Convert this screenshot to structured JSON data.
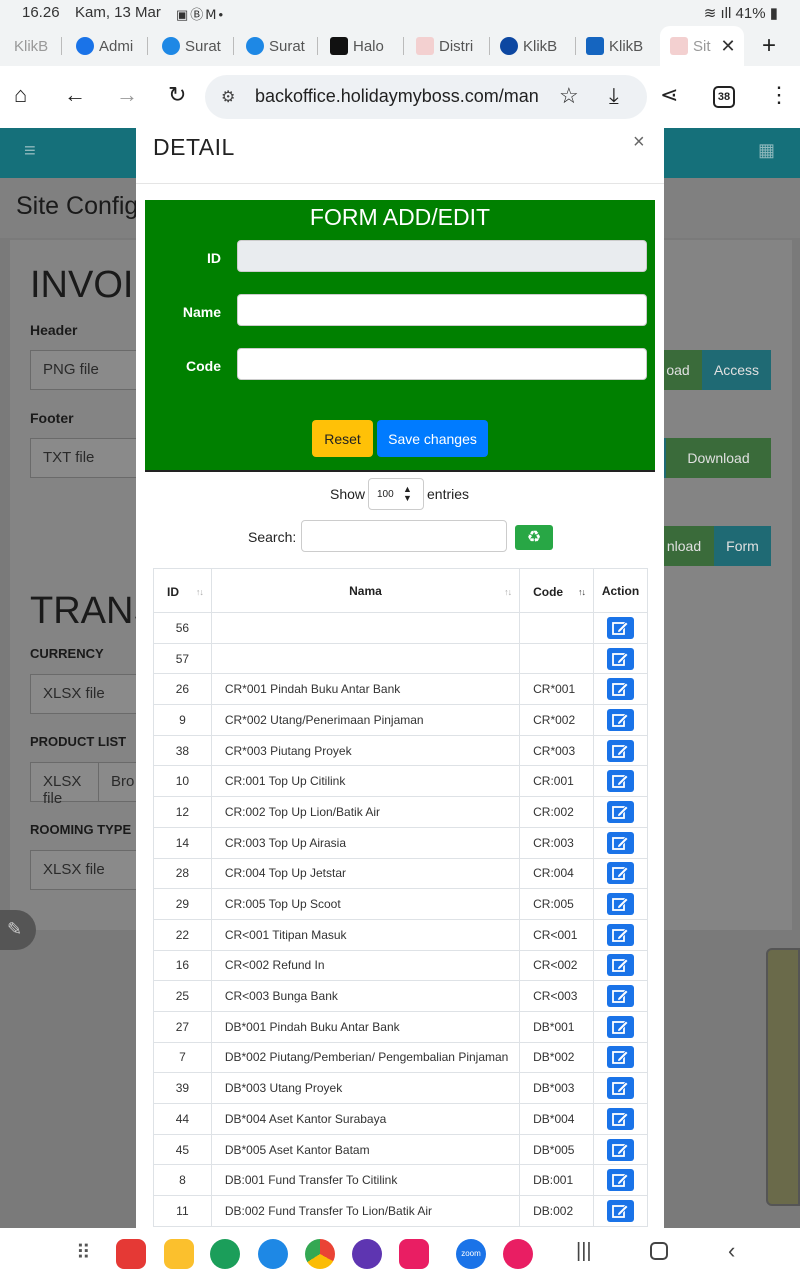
{
  "status": {
    "time": "16.26",
    "date": "Kam, 13 Mar",
    "battery": "41%"
  },
  "tabs": [
    {
      "label": "KlikB",
      "icon": "bank-icon"
    },
    {
      "label": "Admi",
      "icon": "plus-circle-icon"
    },
    {
      "label": "Surat",
      "icon": "plane-icon"
    },
    {
      "label": "Surat",
      "icon": "plane-icon"
    },
    {
      "label": "Halo",
      "icon": "x-logo-icon"
    },
    {
      "label": "Distri",
      "icon": "page-icon"
    },
    {
      "label": "KlikB",
      "icon": "bca-icon"
    },
    {
      "label": "KlikB",
      "icon": "card-icon"
    },
    {
      "label": "Sit",
      "icon": "page-icon"
    }
  ],
  "url": {
    "text": "backoffice.holidaymyboss.com/mana",
    "tab_count": "38"
  },
  "background_page": {
    "title": "Site Config",
    "invoice_heading": "INVOI",
    "header_label": "Header",
    "header_file": "PNG file",
    "footer_label": "Footer",
    "footer_file": "TXT file",
    "btn_load": "oad",
    "btn_access": "Access",
    "btn_download": "Download",
    "btn_nload": "nload",
    "btn_form": "Form",
    "trans_heading": "TRANS",
    "currency_label": "CURRENCY",
    "currency_file": "XLSX file",
    "product_label": "PRODUCT LIST",
    "product_file": "XLSX file",
    "product_browse": "Bro",
    "rooming_label": "ROOMING TYPE",
    "rooming_file": "XLSX file"
  },
  "modal": {
    "title": "DETAIL",
    "close": "×",
    "form": {
      "title": "FORM ADD/EDIT",
      "id_label": "ID",
      "name_label": "Name",
      "code_label": "Code",
      "id_value": "",
      "name_value": "",
      "code_value": "",
      "reset_label": "Reset",
      "save_label": "Save changes"
    },
    "show_label": "Show",
    "show_value": "100",
    "entries_label": "entries",
    "search_label": "Search:",
    "search_value": ""
  },
  "table": {
    "headers": {
      "id": "ID",
      "nama": "Nama",
      "code": "Code",
      "action": "Action"
    },
    "rows": [
      {
        "id": "56",
        "nama": "",
        "code": ""
      },
      {
        "id": "57",
        "nama": "",
        "code": ""
      },
      {
        "id": "26",
        "nama": "CR*001 Pindah Buku Antar Bank",
        "code": "CR*001"
      },
      {
        "id": "9",
        "nama": "CR*002 Utang/Penerimaan Pinjaman",
        "code": "CR*002"
      },
      {
        "id": "38",
        "nama": "CR*003 Piutang Proyek",
        "code": "CR*003"
      },
      {
        "id": "10",
        "nama": "CR:001 Top Up Citilink",
        "code": "CR:001"
      },
      {
        "id": "12",
        "nama": "CR:002 Top Up Lion/Batik Air",
        "code": "CR:002"
      },
      {
        "id": "14",
        "nama": "CR:003 Top Up Airasia",
        "code": "CR:003"
      },
      {
        "id": "28",
        "nama": "CR:004 Top Up Jetstar",
        "code": "CR:004"
      },
      {
        "id": "29",
        "nama": "CR:005 Top Up Scoot",
        "code": "CR:005"
      },
      {
        "id": "22",
        "nama": "CR<001 Titipan Masuk",
        "code": "CR<001"
      },
      {
        "id": "16",
        "nama": "CR<002 Refund In",
        "code": "CR<002"
      },
      {
        "id": "25",
        "nama": "CR<003 Bunga Bank",
        "code": "CR<003"
      },
      {
        "id": "27",
        "nama": "DB*001 Pindah Buku Antar Bank",
        "code": "DB*001"
      },
      {
        "id": "7",
        "nama": "DB*002 Piutang/Pemberian/ Pengembalian Pinjaman",
        "code": "DB*002"
      },
      {
        "id": "39",
        "nama": "DB*003 Utang Proyek",
        "code": "DB*003"
      },
      {
        "id": "44",
        "nama": "DB*004 Aset Kantor Surabaya",
        "code": "DB*004"
      },
      {
        "id": "45",
        "nama": "DB*005 Aset Kantor Batam",
        "code": "DB*005"
      },
      {
        "id": "8",
        "nama": "DB:001 Fund Transfer To Citilink",
        "code": "DB:001"
      },
      {
        "id": "11",
        "nama": "DB:002 Fund Transfer To Lion/Batik Air",
        "code": "DB:002"
      }
    ]
  },
  "dock": {
    "zoom_label": "zoom"
  },
  "colors": {
    "form_bg": "#008000",
    "reset_btn": "#ffc107",
    "save_btn": "#007bff",
    "edit_btn": "#1a73e8",
    "refresh_btn": "#28a745",
    "navbar": "#15707a"
  }
}
